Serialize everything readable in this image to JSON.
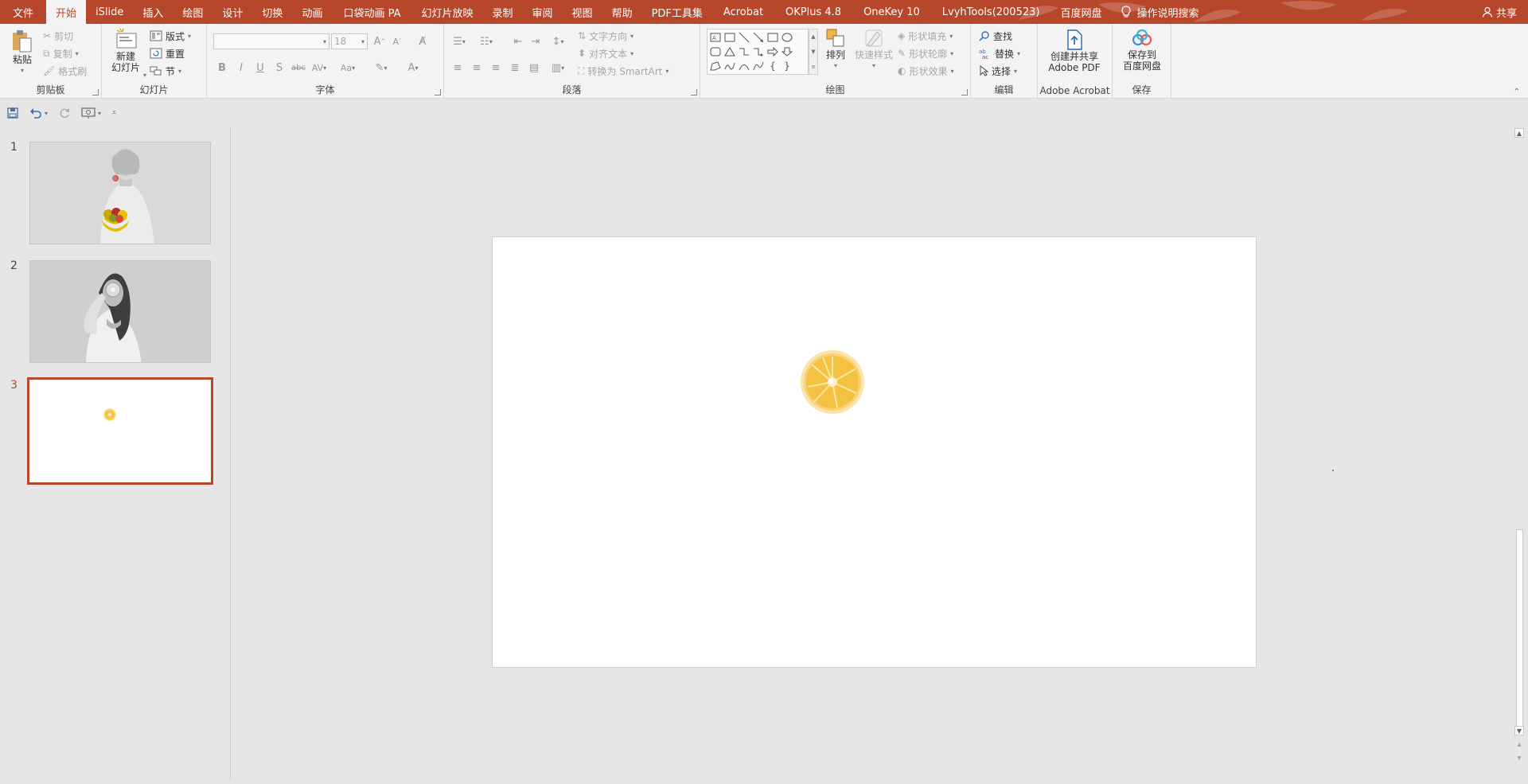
{
  "menubar": {
    "items": [
      "文件",
      "开始",
      "iSlide",
      "插入",
      "绘图",
      "设计",
      "切换",
      "动画",
      "口袋动画 PA",
      "幻灯片放映",
      "录制",
      "审阅",
      "视图",
      "帮助",
      "PDF工具集",
      "Acrobat",
      "OKPlus 4.8",
      "OneKey 10",
      "LvyhTools(200523)",
      "百度网盘"
    ],
    "active_index": 1,
    "search_label": "操作说明搜索",
    "share_label": "共享"
  },
  "ribbon": {
    "clipboard": {
      "paste": "粘贴",
      "cut": "剪切",
      "copy": "复制",
      "format_painter": "格式刷",
      "label": "剪贴板"
    },
    "slides": {
      "new_slide_line1": "新建",
      "new_slide_line2": "幻灯片",
      "layout": "版式",
      "reset": "重置",
      "section": "节",
      "label": "幻灯片"
    },
    "font": {
      "font_name": "",
      "font_size": "18",
      "label": "字体"
    },
    "paragraph": {
      "text_direction": "文字方向",
      "align_text": "对齐文本",
      "smartart": "转换为 SmartArt",
      "label": "段落"
    },
    "drawing": {
      "arrange": "排列",
      "quick_styles": "快速样式",
      "shape_fill": "形状填充",
      "shape_outline": "形状轮廓",
      "shape_effects": "形状效果",
      "label": "绘图"
    },
    "editing": {
      "find": "查找",
      "replace": "替换",
      "select": "选择",
      "label": "编辑"
    },
    "acrobat": {
      "line1": "创建并共享",
      "line2": "Adobe PDF",
      "label": "Adobe Acrobat"
    },
    "save": {
      "line1": "保存到",
      "line2": "百度网盘",
      "label": "保存"
    }
  },
  "slides": [
    {
      "number": "1",
      "selected": false,
      "description": "woman-with-fruit-bowl"
    },
    {
      "number": "2",
      "selected": false,
      "description": "woman-with-orange-slice"
    },
    {
      "number": "3",
      "selected": true,
      "description": "orange-slice"
    }
  ],
  "colors": {
    "accent": "#b7472a",
    "ribbon_bg": "#f3f3f3",
    "workspace_bg": "#e6e6e6",
    "orange": "#f7c548"
  }
}
